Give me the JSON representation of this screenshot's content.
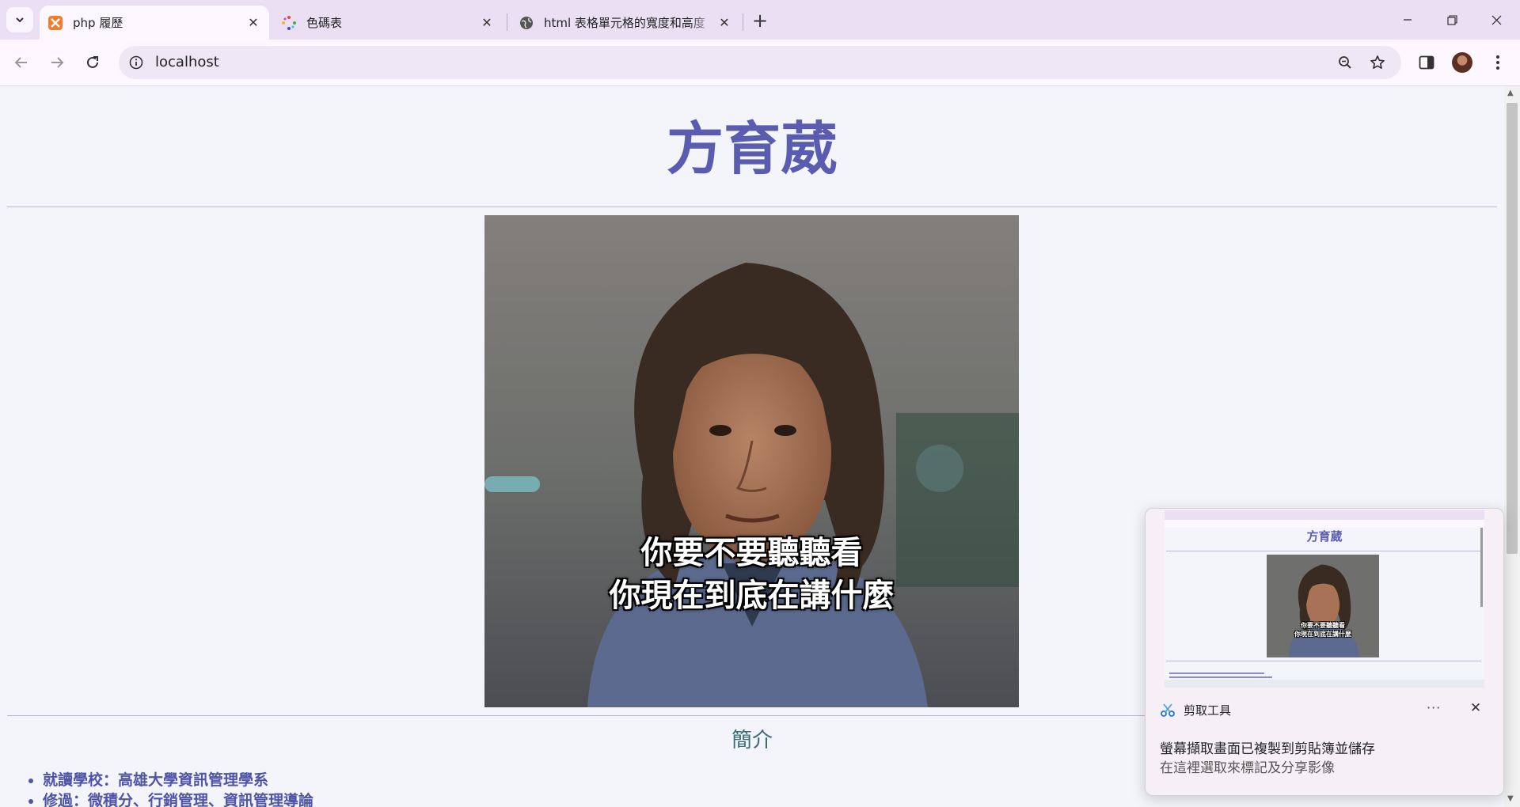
{
  "browser": {
    "tabs": [
      {
        "title": "php 履歷",
        "icon": "xampp-icon",
        "active": true
      },
      {
        "title": "色碼表",
        "icon": "color-dots-icon",
        "active": false
      },
      {
        "title": "html 表格單元格的寬度和高度",
        "icon": "globe-icon",
        "active": false
      }
    ],
    "address": "localhost"
  },
  "page": {
    "name": "方育葳",
    "photo_caption_line1": "你要不要聽聽看",
    "photo_caption_line2": "你現在到底在講什麼",
    "section_title": "簡介",
    "info": [
      "就讀學校：高雄大學資訊管理學系",
      "修過：微積分、行銷管理、資訊管理導論"
    ]
  },
  "toast": {
    "app_name": "剪取工具",
    "message": "螢幕擷取畫面已複製到剪貼簿並儲存",
    "sub_message": "在這裡選取來標記及分享影像",
    "thumb_title": "方育葳",
    "thumb_caption_line1": "你要不要聽聽看",
    "thumb_caption_line2": "你現在到底在講什麼"
  },
  "colors": {
    "heading": "#5a5cb0",
    "section": "#3a6b77",
    "list": "#4f54a6",
    "page_bg": "#f3f5fb",
    "tabbar_bg": "#eadff3"
  }
}
